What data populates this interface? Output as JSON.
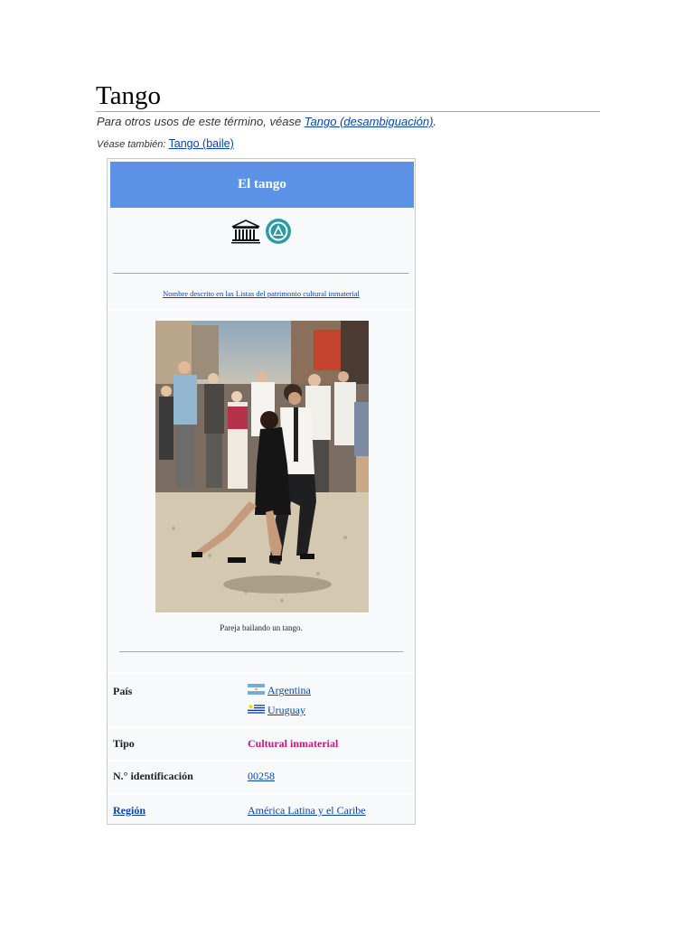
{
  "article": {
    "title": "Tango",
    "hatnote1_prefix": "Para otros usos de este término, véase ",
    "hatnote1_link": "Tango (desambiguación)",
    "hatnote1_suffix": ".",
    "hatnote2_prefix": "Véase también: ",
    "hatnote2_link": "Tango (baile)"
  },
  "infobox": {
    "header": "El tango",
    "logos": [
      "unesco-logo",
      "intangible-heritage-emblem"
    ],
    "list_link": "Nombre descrito en las Listas del patrimonio cultural inmaterial",
    "image_caption": "Pareja bailando un tango.",
    "rows": {
      "pais_label": "País",
      "pais_values": [
        "Argentina",
        "Uruguay"
      ],
      "tipo_label": "Tipo",
      "tipo_value": "Cultural inmaterial",
      "id_label": "N.° identificación",
      "id_value": "00258",
      "region_label": "Región",
      "region_value": "América Latina y el Caribe"
    },
    "colors": {
      "header_bg": "#5b92e5",
      "link": "#0645ad",
      "type_text": "#c4167f"
    }
  }
}
